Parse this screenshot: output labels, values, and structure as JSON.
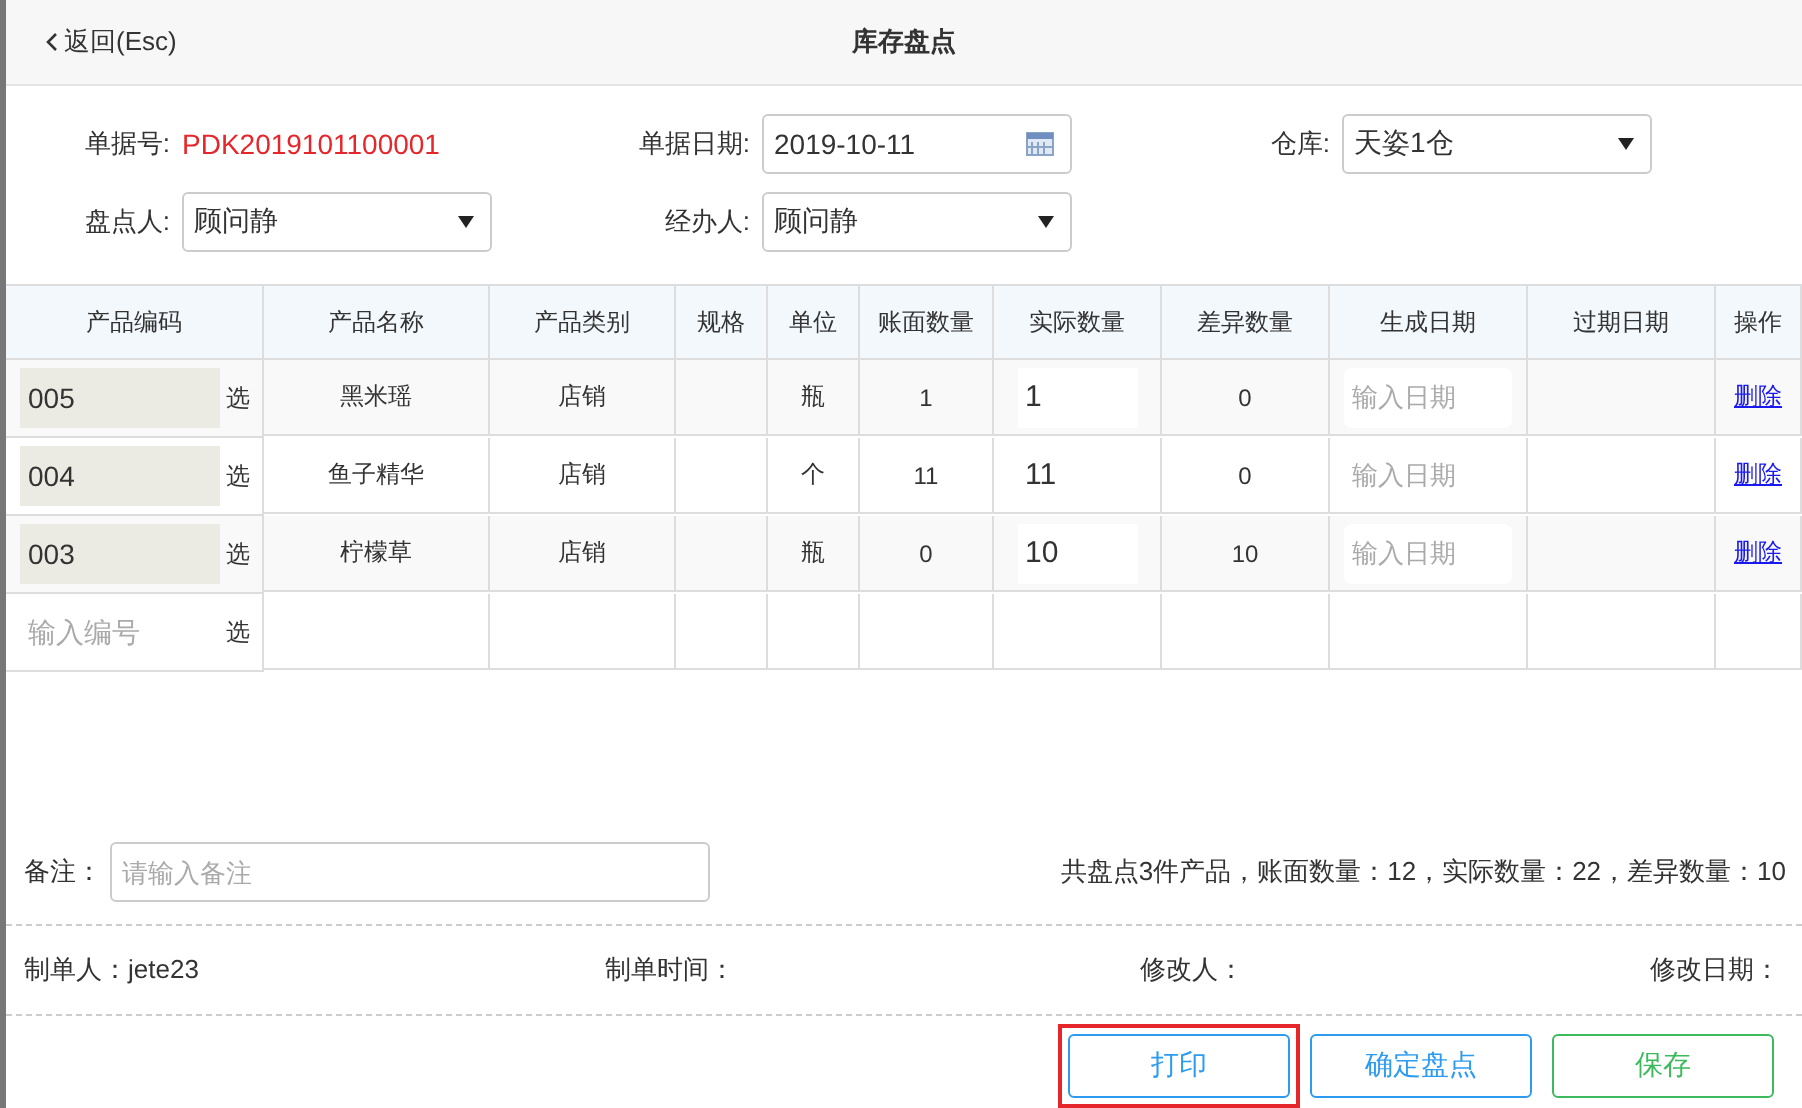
{
  "header": {
    "back": "返回(Esc)",
    "title": "库存盘点"
  },
  "form": {
    "doc_no_label": "单据号:",
    "doc_no": "PDK2019101100001",
    "date_label": "单据日期:",
    "date": "2019-10-11",
    "warehouse_label": "仓库:",
    "warehouse": "天姿1仓",
    "counter_label": "盘点人:",
    "counter": "顾问静",
    "handler_label": "经办人:",
    "handler": "顾问静"
  },
  "table": {
    "columns": [
      "产品编码",
      "产品名称",
      "产品类别",
      "规格",
      "单位",
      "账面数量",
      "实际数量",
      "差异数量",
      "生成日期",
      "过期日期",
      "操作"
    ],
    "rows": [
      {
        "code": "005",
        "pick": "选",
        "name": "黑米瑶",
        "category": "店销",
        "unit": "瓶",
        "book": "1",
        "actual": "1",
        "diff": "0",
        "date_placeholder": "输入日期",
        "action": "删除"
      },
      {
        "code": "004",
        "pick": "选",
        "name": "鱼子精华",
        "category": "店销",
        "unit": "个",
        "book": "11",
        "actual": "11",
        "diff": "0",
        "date_placeholder": "输入日期",
        "action": "删除"
      },
      {
        "code": "003",
        "pick": "选",
        "name": "柠檬草",
        "category": "店销",
        "unit": "瓶",
        "book": "0",
        "actual": "10",
        "diff": "10",
        "date_placeholder": "输入日期",
        "action": "删除"
      }
    ],
    "new_row": {
      "code_placeholder": "输入编号",
      "pick": "选"
    }
  },
  "remark": {
    "label": "备注：",
    "placeholder": "请输入备注"
  },
  "summary": "共盘点3件产品，账面数量：12，实际数量：22，差异数量：10",
  "meta": [
    "制单人：jete23",
    "制单时间：",
    "修改人：",
    "修改日期："
  ],
  "buttons": [
    {
      "label": "打印",
      "kind": "plain",
      "highlighted": true
    },
    {
      "label": "确定盘点",
      "kind": "primary",
      "highlighted": false
    },
    {
      "label": "保存",
      "kind": "success",
      "highlighted": false
    }
  ]
}
